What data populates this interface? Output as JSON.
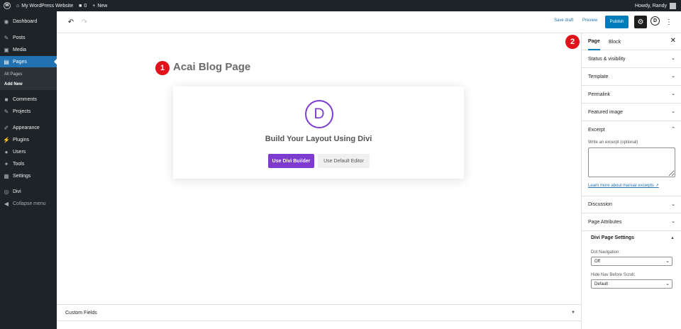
{
  "admin_bar": {
    "site_name": "My WordPress Website",
    "comments_count": "0",
    "new_label": "New",
    "howdy": "Howdy, Randy"
  },
  "sidebar": {
    "items": [
      {
        "label": "Dashboard",
        "icon": "dashboard-icon"
      },
      {
        "label": "Posts",
        "icon": "pin-icon"
      },
      {
        "label": "Media",
        "icon": "media-icon"
      },
      {
        "label": "Pages",
        "icon": "pages-icon"
      },
      {
        "label": "Comments",
        "icon": "comment-icon"
      },
      {
        "label": "Projects",
        "icon": "pin-icon"
      },
      {
        "label": "Appearance",
        "icon": "brush-icon"
      },
      {
        "label": "Plugins",
        "icon": "plug-icon"
      },
      {
        "label": "Users",
        "icon": "user-icon"
      },
      {
        "label": "Tools",
        "icon": "wrench-icon"
      },
      {
        "label": "Settings",
        "icon": "settings-icon"
      },
      {
        "label": "Divi",
        "icon": "divi-icon"
      },
      {
        "label": "Collapse menu",
        "icon": "collapse-icon"
      }
    ],
    "submenu": {
      "all_pages": "All Pages",
      "add_new": "Add New"
    }
  },
  "header": {
    "save_draft": "Save draft",
    "preview": "Preview",
    "publish": "Publish",
    "divi_letter": "D"
  },
  "canvas": {
    "badge1": "1",
    "title": "Acai Blog Page",
    "divi_letter": "D",
    "build_heading": "Build Your Layout Using Divi",
    "use_divi_builder": "Use Divi Builder",
    "use_default_editor": "Use Default Editor"
  },
  "custom_fields": {
    "label": "Custom Fields"
  },
  "panel": {
    "badge2": "2",
    "tab_page": "Page",
    "tab_block": "Block",
    "sections": {
      "status": "Status & visibility",
      "template": "Template",
      "permalink": "Permalink",
      "featured_image": "Featured image",
      "excerpt": "Excerpt",
      "discussion": "Discussion",
      "page_attributes": "Page Attributes"
    },
    "excerpt_label": "Write an excerpt (optional)",
    "excerpt_link": "Learn more about manual excerpts",
    "divi_settings": {
      "title": "Divi Page Settings",
      "dot_nav_label": "Dot Navigation:",
      "dot_nav_value": "Off",
      "hide_nav_label": "Hide Nav Before Scroll:",
      "hide_nav_value": "Default"
    }
  }
}
